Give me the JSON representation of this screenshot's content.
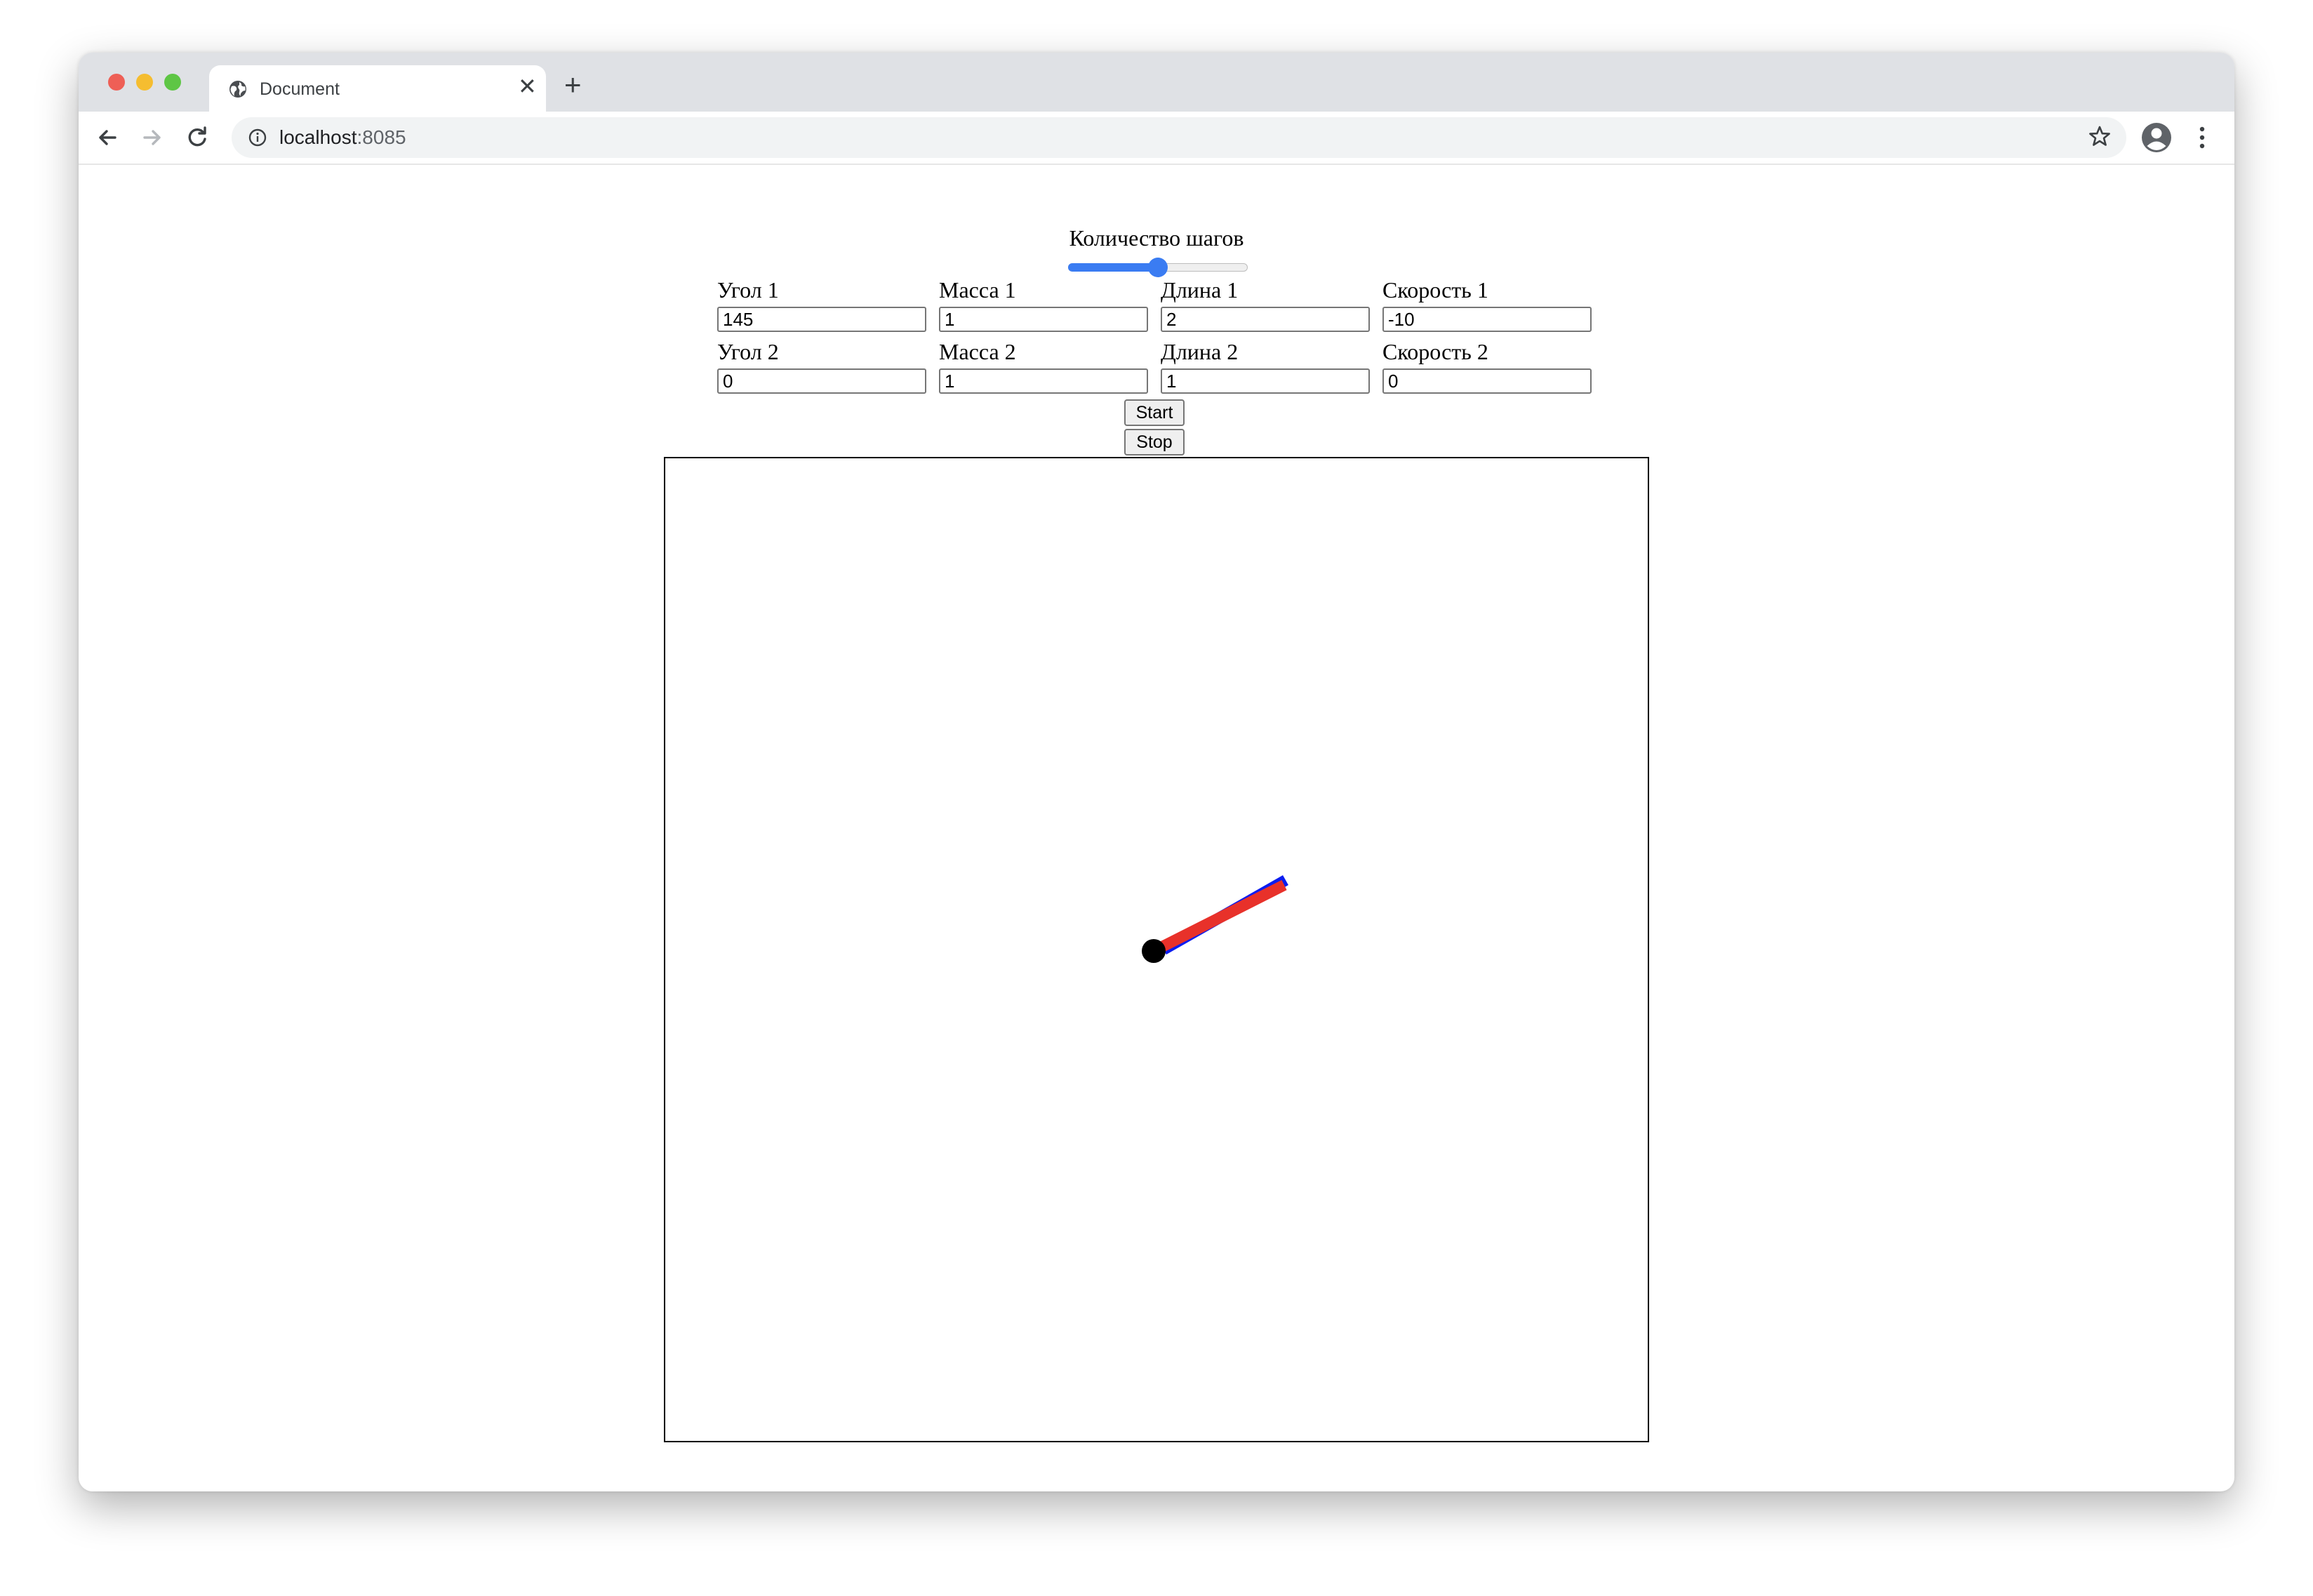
{
  "browser": {
    "tab_title": "Document",
    "address_host": "localhost",
    "address_port": ":8085"
  },
  "controls": {
    "steps_label": "Количество шагов",
    "steps_slider_fraction": 0.5,
    "fields": [
      {
        "label": "Угол 1",
        "value": "145"
      },
      {
        "label": "Масса 1",
        "value": "1"
      },
      {
        "label": "Длина 1",
        "value": "2"
      },
      {
        "label": "Скорость 1",
        "value": "-10"
      },
      {
        "label": "Угол 2",
        "value": "0"
      },
      {
        "label": "Масса 2",
        "value": "1"
      },
      {
        "label": "Длина 2",
        "value": "1"
      },
      {
        "label": "Скорость 2",
        "value": "0"
      }
    ],
    "start_label": "Start",
    "stop_label": "Stop"
  },
  "simulation": {
    "rod1_color": "#e8312a",
    "rod2_color": "#0b1df0",
    "pivot_color": "#000000"
  }
}
